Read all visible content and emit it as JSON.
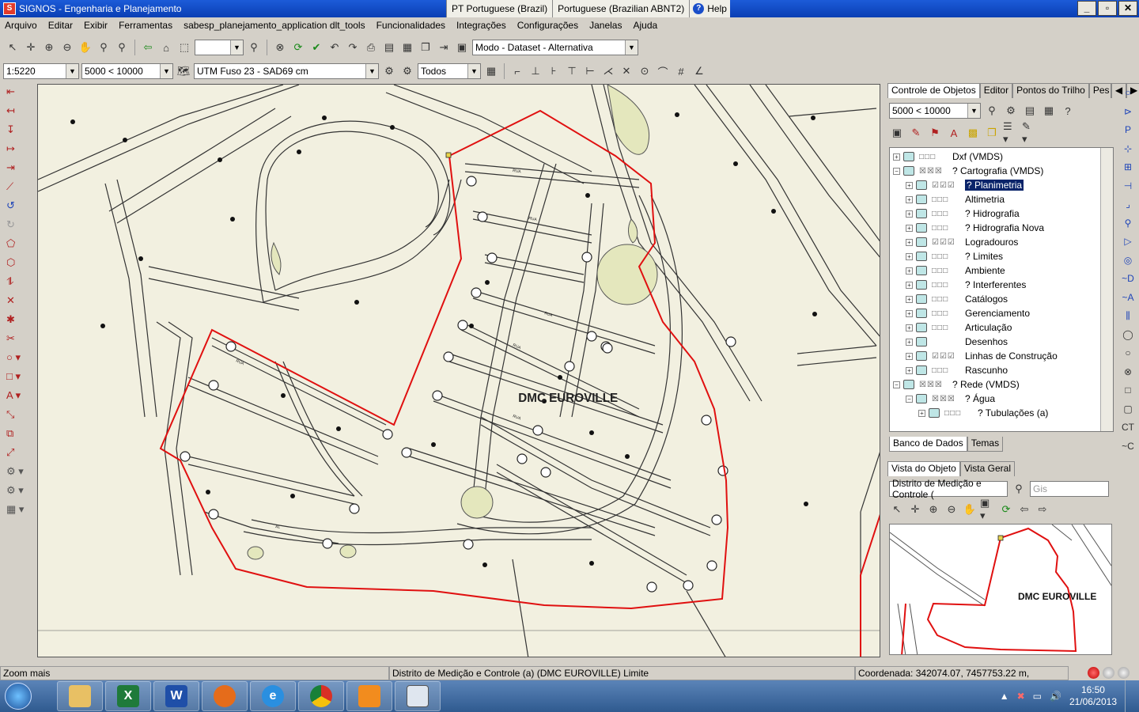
{
  "window": {
    "title": "SIGNOS - Engenharia e Planejamento",
    "lang_tab_1": "PT Portuguese (Brazil)",
    "lang_tab_2": "Portuguese (Brazilian ABNT2)",
    "help": "Help"
  },
  "menu": [
    "Arquivo",
    "Editar",
    "Exibir",
    "Ferramentas",
    "sabesp_planejamento_application dlt_tools",
    "Funcionalidades",
    "Integrações",
    "Configurações",
    "Janelas",
    "Ajuda"
  ],
  "toolbar": {
    "mode_combo": "Modo - Dataset - Alternativa",
    "scale_combo": "1:5220",
    "scale_range": "5000 < 10000",
    "projection": "UTM Fuso 23 - SAD69 cm",
    "filter": "Todos"
  },
  "map": {
    "label": "DMC EUROVILLE"
  },
  "object_panel": {
    "tabs": [
      "Controle de Objetos",
      "Editor",
      "Pontos do Trilho",
      "Pes"
    ],
    "scale_combo": "5000 < 10000",
    "tree": [
      {
        "depth": 0,
        "checks": "□□□",
        "label": "Dxf (VMDS)"
      },
      {
        "depth": 0,
        "checks": "☒☒☒",
        "label": "? Cartografia (VMDS)"
      },
      {
        "depth": 1,
        "checks": "☑☑☑",
        "label": "? Planimetria",
        "selected": true
      },
      {
        "depth": 1,
        "checks": "□□□",
        "label": "Altimetria"
      },
      {
        "depth": 1,
        "checks": "□□□",
        "label": "? Hidrografia"
      },
      {
        "depth": 1,
        "checks": "□□□",
        "label": "? Hidrografia Nova"
      },
      {
        "depth": 1,
        "checks": "☑☑☑",
        "label": "Logradouros"
      },
      {
        "depth": 1,
        "checks": "□□□",
        "label": "? Limites"
      },
      {
        "depth": 1,
        "checks": "□□□",
        "label": "Ambiente"
      },
      {
        "depth": 1,
        "checks": "□□□",
        "label": "? Interferentes"
      },
      {
        "depth": 1,
        "checks": "□□□",
        "label": "Catálogos"
      },
      {
        "depth": 1,
        "checks": "□□□",
        "label": "Gerenciamento"
      },
      {
        "depth": 1,
        "checks": "□□□",
        "label": "Articulação"
      },
      {
        "depth": 1,
        "checks": "",
        "label": "Desenhos"
      },
      {
        "depth": 1,
        "checks": "☑☑☑",
        "label": "Linhas de Construção"
      },
      {
        "depth": 1,
        "checks": "□□□",
        "label": "Rascunho"
      },
      {
        "depth": 0,
        "checks": "☒☒☒",
        "label": "? Rede (VMDS)"
      },
      {
        "depth": 1,
        "checks": "☒☒☒",
        "label": "? Água"
      },
      {
        "depth": 2,
        "checks": "□□□",
        "label": "? Tubulações (a)"
      }
    ],
    "bottom_tabs": [
      "Banco de Dados",
      "Temas"
    ]
  },
  "overview_panel": {
    "tabs": [
      "Vista do Objeto",
      "Vista Geral"
    ],
    "object_name": "Distrito de Medição e Controle (",
    "gis_placeholder": "Gis",
    "label": "DMC EUROVILLE"
  },
  "status": {
    "hint": "Zoom mais",
    "object": "Distrito de Medição e Controle (a) (DMC EUROVILLE) Limite",
    "coord": "Coordenada: 342074.07, 7457753.22 m,"
  },
  "taskbar": {
    "time": "16:50",
    "date": "21/06/2013"
  },
  "colors": {
    "titlebar": "#0a3fb4",
    "map_bg": "#f2f0e0",
    "boundary": "#e01010",
    "selection": "#0a246a"
  }
}
